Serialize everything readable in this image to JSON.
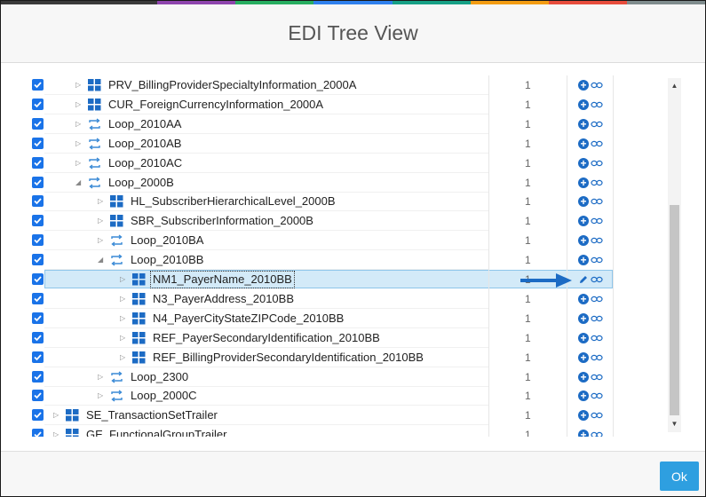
{
  "dialog": {
    "title": "EDI Tree View",
    "ok_label": "Ok"
  },
  "colors": {
    "stripe": [
      "#3a3a3a",
      "#3a3a3a",
      "#8e44ad",
      "#27ae60",
      "#2f80ed",
      "#16a085",
      "#f39c12",
      "#e74c3c",
      "#7f8c8d"
    ],
    "checkbox": "#1a73e8",
    "accent": "#1c6bc4",
    "selected_row": "#d3eaf8",
    "ok_button": "#2e9fe0"
  },
  "tree": {
    "rows": [
      {
        "label": "PRV_BillingProviderSpecialtyInformation_2000A",
        "count": "1",
        "icon": "segment-icon",
        "expander": "collapsed",
        "level": 1,
        "selected": false
      },
      {
        "label": "CUR_ForeignCurrencyInformation_2000A",
        "count": "1",
        "icon": "segment-icon",
        "expander": "collapsed",
        "level": 1,
        "selected": false
      },
      {
        "label": "Loop_2010AA",
        "count": "1",
        "icon": "loop-icon",
        "expander": "collapsed",
        "level": 1,
        "selected": false
      },
      {
        "label": "Loop_2010AB",
        "count": "1",
        "icon": "loop-icon",
        "expander": "collapsed",
        "level": 1,
        "selected": false
      },
      {
        "label": "Loop_2010AC",
        "count": "1",
        "icon": "loop-icon",
        "expander": "collapsed",
        "level": 1,
        "selected": false
      },
      {
        "label": "Loop_2000B",
        "count": "1",
        "icon": "loop-icon",
        "expander": "expanded",
        "level": 1,
        "selected": false
      },
      {
        "label": "HL_SubscriberHierarchicalLevel_2000B",
        "count": "1",
        "icon": "segment-icon",
        "expander": "collapsed",
        "level": 2,
        "selected": false
      },
      {
        "label": "SBR_SubscriberInformation_2000B",
        "count": "1",
        "icon": "segment-icon",
        "expander": "collapsed",
        "level": 2,
        "selected": false
      },
      {
        "label": "Loop_2010BA",
        "count": "1",
        "icon": "loop-icon",
        "expander": "collapsed",
        "level": 2,
        "selected": false
      },
      {
        "label": "Loop_2010BB",
        "count": "1",
        "icon": "loop-icon",
        "expander": "expanded",
        "level": 2,
        "selected": false
      },
      {
        "label": "NM1_PayerName_2010BB",
        "count": "1",
        "icon": "segment-icon",
        "expander": "collapsed",
        "level": 3,
        "selected": true
      },
      {
        "label": "N3_PayerAddress_2010BB",
        "count": "1",
        "icon": "segment-icon",
        "expander": "collapsed",
        "level": 3,
        "selected": false
      },
      {
        "label": "N4_PayerCityStateZIPCode_2010BB",
        "count": "1",
        "icon": "segment-icon",
        "expander": "collapsed",
        "level": 3,
        "selected": false
      },
      {
        "label": "REF_PayerSecondaryIdentification_2010BB",
        "count": "1",
        "icon": "segment-icon",
        "expander": "collapsed",
        "level": 3,
        "selected": false
      },
      {
        "label": "REF_BillingProviderSecondaryIdentification_2010BB",
        "count": "1",
        "icon": "segment-icon",
        "expander": "collapsed",
        "level": 3,
        "selected": false
      },
      {
        "label": "Loop_2300",
        "count": "1",
        "icon": "loop-icon",
        "expander": "collapsed",
        "level": 2,
        "selected": false
      },
      {
        "label": "Loop_2000C",
        "count": "1",
        "icon": "loop-icon",
        "expander": "collapsed",
        "level": 2,
        "selected": false
      },
      {
        "label": "SE_TransactionSetTrailer",
        "count": "1",
        "icon": "segment-icon",
        "expander": "collapsed",
        "level": 0,
        "selected": false
      },
      {
        "label": "GE_FunctionalGroupTrailer",
        "count": "1",
        "icon": "segment-icon",
        "expander": "collapsed",
        "level": 0,
        "selected": false
      }
    ]
  }
}
